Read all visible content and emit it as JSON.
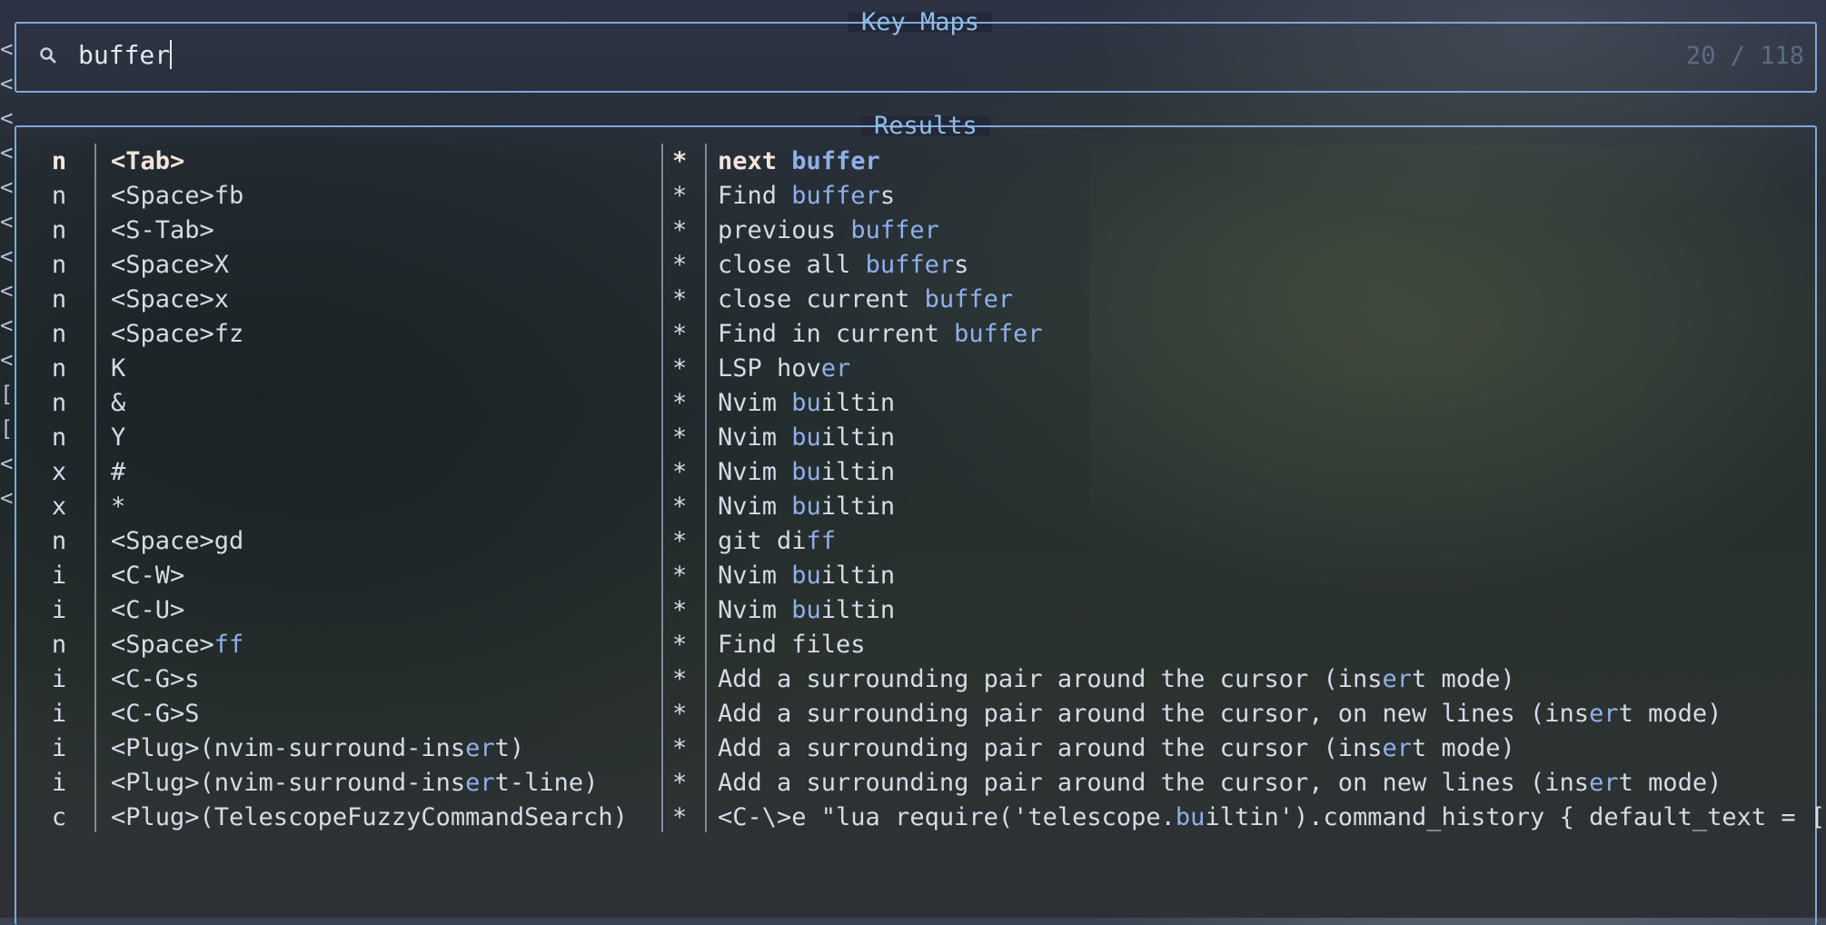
{
  "prompt": {
    "title": "Key Maps",
    "query": "buffer",
    "count": "20 / 118"
  },
  "results": {
    "title": "Results",
    "rows": [
      {
        "mode": "n",
        "key": "<Tab>",
        "star": "*",
        "desc": [
          [
            "next ",
            0
          ],
          [
            "buffer",
            1
          ]
        ]
      },
      {
        "mode": "n",
        "key": "<Space>fb",
        "star": "*",
        "desc": [
          [
            "Find ",
            0
          ],
          [
            "buffer",
            1
          ],
          [
            "s",
            0
          ]
        ]
      },
      {
        "mode": "n",
        "key": "<S-Tab>",
        "star": "*",
        "desc": [
          [
            "previous ",
            0
          ],
          [
            "buffer",
            1
          ]
        ]
      },
      {
        "mode": "n",
        "key": "<Space>X",
        "star": "*",
        "desc": [
          [
            "close all ",
            0
          ],
          [
            "buffer",
            1
          ],
          [
            "s",
            0
          ]
        ]
      },
      {
        "mode": "n",
        "key": "<Space>x",
        "star": "*",
        "desc": [
          [
            "close current ",
            0
          ],
          [
            "buffer",
            1
          ]
        ]
      },
      {
        "mode": "n",
        "key": "<Space>fz",
        "star": "*",
        "desc": [
          [
            "Find in current ",
            0
          ],
          [
            "buffer",
            1
          ]
        ]
      },
      {
        "mode": "n",
        "key": "K",
        "star": "*",
        "desc": [
          [
            "LSP hov",
            0
          ],
          [
            "er",
            1
          ]
        ]
      },
      {
        "mode": "n",
        "key": "&",
        "star": "*",
        "desc": [
          [
            "Nvim ",
            0
          ],
          [
            "bu",
            1
          ],
          [
            "iltin",
            0
          ]
        ]
      },
      {
        "mode": "n",
        "key": "Y",
        "star": "*",
        "desc": [
          [
            "Nvim ",
            0
          ],
          [
            "bu",
            1
          ],
          [
            "iltin",
            0
          ]
        ]
      },
      {
        "mode": "x",
        "key": "#",
        "star": "*",
        "desc": [
          [
            "Nvim ",
            0
          ],
          [
            "bu",
            1
          ],
          [
            "iltin",
            0
          ]
        ]
      },
      {
        "mode": "x",
        "key": "*",
        "star": "*",
        "desc": [
          [
            "Nvim ",
            0
          ],
          [
            "bu",
            1
          ],
          [
            "iltin",
            0
          ]
        ]
      },
      {
        "mode": "n",
        "key": "<Space>gd",
        "star": "*",
        "desc": [
          [
            "git di",
            0
          ],
          [
            "ff",
            1
          ]
        ]
      },
      {
        "mode": "i",
        "key": "<C-W>",
        "star": "*",
        "desc": [
          [
            "Nvim ",
            0
          ],
          [
            "bu",
            1
          ],
          [
            "iltin",
            0
          ]
        ]
      },
      {
        "mode": "i",
        "key": "<C-U>",
        "star": "*",
        "desc": [
          [
            "Nvim ",
            0
          ],
          [
            "bu",
            1
          ],
          [
            "iltin",
            0
          ]
        ]
      },
      {
        "mode": "n",
        "key": "<Space>ff",
        "key_hl": [
          [
            "<Space>",
            0
          ],
          [
            "ff",
            1
          ]
        ],
        "star": "*",
        "desc": [
          [
            "Find files",
            0
          ]
        ]
      },
      {
        "mode": "i",
        "key": "<C-G>s",
        "star": "*",
        "desc": [
          [
            "Add a surrounding pair around the cursor (ins",
            0
          ],
          [
            "er",
            1
          ],
          [
            "t mode)",
            0
          ]
        ]
      },
      {
        "mode": "i",
        "key": "<C-G>S",
        "star": "*",
        "desc": [
          [
            "Add a surrounding pair around the cursor, on new lines (ins",
            0
          ],
          [
            "er",
            1
          ],
          [
            "t mode)",
            0
          ]
        ]
      },
      {
        "mode": "i",
        "key": "<Plug>(nvim-surround-insert)",
        "key_hl": [
          [
            "<Plug>(nvim-surround-ins",
            0
          ],
          [
            "er",
            1
          ],
          [
            "t)",
            0
          ]
        ],
        "star": "*",
        "desc": [
          [
            "Add a surrounding pair around the cursor (ins",
            0
          ],
          [
            "er",
            1
          ],
          [
            "t mode)",
            0
          ]
        ]
      },
      {
        "mode": "i",
        "key": "<Plug>(nvim-surround-insert-line)",
        "key_hl": [
          [
            "<Plug>(nvim-surround-ins",
            0
          ],
          [
            "er",
            1
          ],
          [
            "t-line)",
            0
          ]
        ],
        "star": "*",
        "desc": [
          [
            "Add a surrounding pair around the cursor, on new lines (ins",
            0
          ],
          [
            "er",
            1
          ],
          [
            "t mode)",
            0
          ]
        ]
      },
      {
        "mode": "c",
        "key": "<Plug>(TelescopeFuzzyCommandSearch)",
        "star": "*",
        "desc": [
          [
            "<C-\\>e \"lua require('telescope.",
            0
          ],
          [
            "bu",
            1
          ],
          [
            "iltin').command_history { default_text = [",
            0
          ]
        ]
      }
    ]
  },
  "gutter_marks": [
    "<",
    "<",
    "<",
    "<",
    "<",
    "<",
    "<",
    "<",
    "<",
    "<",
    "[",
    "[",
    "<",
    "<"
  ],
  "colors": {
    "border": "#7fa7d9",
    "title": "#8fbde8",
    "match": "#8fb0ea",
    "selected": "#f5e4dc"
  }
}
